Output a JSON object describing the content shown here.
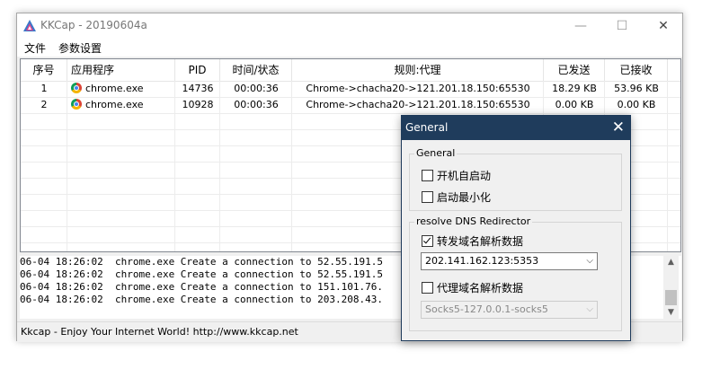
{
  "window": {
    "title": "KKCap - 20190604a",
    "controls": {
      "minimize": "—",
      "maximize": "☐",
      "close": "✕"
    }
  },
  "menu": {
    "items": [
      "文件",
      "参数设置"
    ]
  },
  "table": {
    "headers": [
      "序号",
      "应用程序",
      "PID",
      "时间/状态",
      "规则:代理",
      "已发送",
      "已接收"
    ],
    "rows": [
      {
        "index": "1",
        "app": "chrome.exe",
        "pid": "14736",
        "time": "00:00:36",
        "rule": "Chrome->chacha20->121.201.18.150:65530",
        "sent": "18.29 KB",
        "received": "53.96 KB"
      },
      {
        "index": "2",
        "app": "chrome.exe",
        "pid": "10928",
        "time": "00:00:36",
        "rule": "Chrome->chacha20->121.201.18.150:65530",
        "sent": "0.00 KB",
        "received": "0.00 KB"
      }
    ]
  },
  "log": {
    "lines": [
      "06-04 18:26:02  chrome.exe Create a connection to 52.55.191.5",
      "06-04 18:26:02  chrome.exe Create a connection to 52.55.191.5",
      "06-04 18:26:02  chrome.exe Create a connection to 151.101.76.",
      "06-04 18:26:02  chrome.exe Create a connection to 203.208.43."
    ]
  },
  "status": {
    "text": "Kkcap - Enjoy Your Internet World! http://www.kkcap.net"
  },
  "dialog": {
    "title": "General",
    "close": "✕",
    "general_group": {
      "label": "General",
      "autostart": {
        "label": "开机自启动",
        "checked": false
      },
      "minimize": {
        "label": "启动最小化",
        "checked": false
      }
    },
    "dns_group": {
      "label": "resolve DNS Redirector",
      "forward": {
        "label": "转发域名解析数据",
        "checked": true
      },
      "forward_server": "202.141.162.123:5353",
      "proxy": {
        "label": "代理域名解析数据",
        "checked": false
      },
      "proxy_server": "Socks5-127.0.0.1-socks5"
    }
  }
}
